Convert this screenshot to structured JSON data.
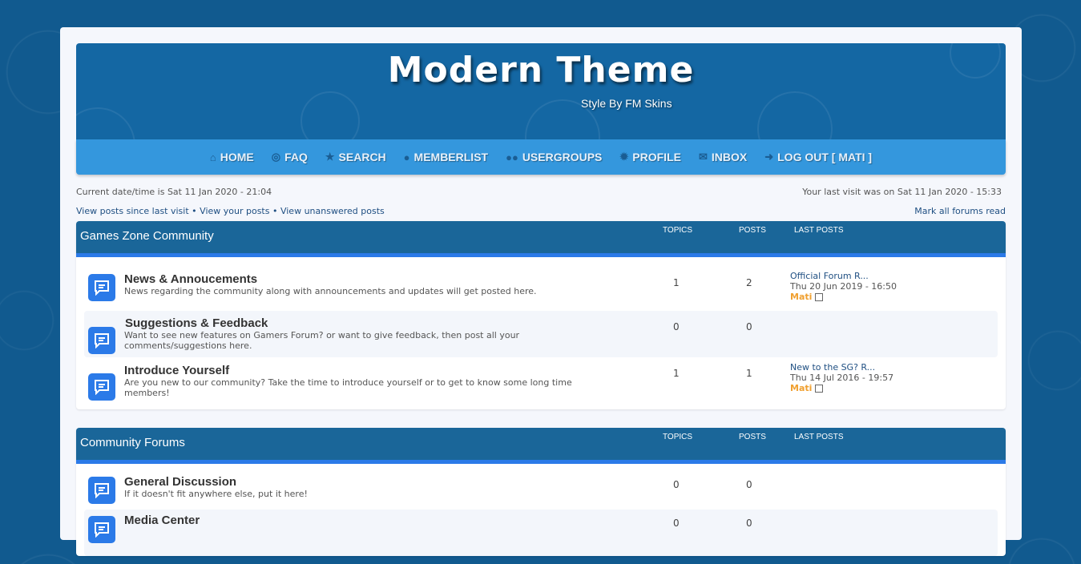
{
  "header": {
    "title": "Modern Theme",
    "subtitle": "Style By FM Skins"
  },
  "nav": [
    {
      "label": "HOME",
      "icon": "home-icon",
      "glyph": "⌂"
    },
    {
      "label": "FAQ",
      "icon": "lifebuoy-icon",
      "glyph": "◎"
    },
    {
      "label": "SEARCH",
      "icon": "star-icon",
      "glyph": "★"
    },
    {
      "label": "MEMBERLIST",
      "icon": "user-icon",
      "glyph": "●"
    },
    {
      "label": "USERGROUPS",
      "icon": "users-icon",
      "glyph": "●●"
    },
    {
      "label": "PROFILE",
      "icon": "gear-icon",
      "glyph": "✹"
    },
    {
      "label": "INBOX",
      "icon": "envelope-icon",
      "glyph": "✉"
    },
    {
      "label": "LOG OUT [ MATI ]",
      "icon": "logout-icon",
      "glyph": "➜"
    }
  ],
  "info": {
    "current_time": "Current date/time is Sat 11 Jan 2020 - 21:04",
    "last_visit": "Your last visit was on Sat 11 Jan 2020 - 15:33",
    "link_since": "View posts since last visit",
    "link_yours": "View your posts",
    "link_unanswered": "View unanswered posts",
    "separator": " • ",
    "mark_read": "Mark all forums read"
  },
  "columns": {
    "topics": "TOPICS",
    "posts": "POSTS",
    "last_posts": "LAST POSTS"
  },
  "categories": [
    {
      "title": "Games Zone Community",
      "forums": [
        {
          "name": "News & Annoucements",
          "desc": "News regarding the community along with announcements and updates will get posted here.",
          "topics": "1",
          "posts": "2",
          "last_title": "Official Forum R...",
          "last_date": "Thu 20 Jun 2019 - 16:50",
          "last_user": "Mati"
        },
        {
          "name": "Suggestions & Feedback",
          "desc": "Want to see new features on Gamers Forum? or want to give feedback, then post all your comments/suggestions here.",
          "topics": "0",
          "posts": "0"
        },
        {
          "name": "Introduce Yourself",
          "desc": "Are you new to our community? Take the time to introduce yourself or to get to know some long time members!",
          "topics": "1",
          "posts": "1",
          "last_title": "New to the SG? R...",
          "last_date": "Thu 14 Jul 2016 - 19:57",
          "last_user": "Mati"
        }
      ]
    },
    {
      "title": "Community Forums",
      "forums": [
        {
          "name": "General Discussion",
          "desc": "If it doesn't fit anywhere else, put it here!",
          "topics": "0",
          "posts": "0"
        },
        {
          "name": "Media Center",
          "desc": "",
          "topics": "0",
          "posts": "0"
        }
      ]
    }
  ],
  "colors": {
    "accent": "#2b7ae8",
    "nav": "#3497dd",
    "header": "#1467a3",
    "user": "#f0a030"
  }
}
